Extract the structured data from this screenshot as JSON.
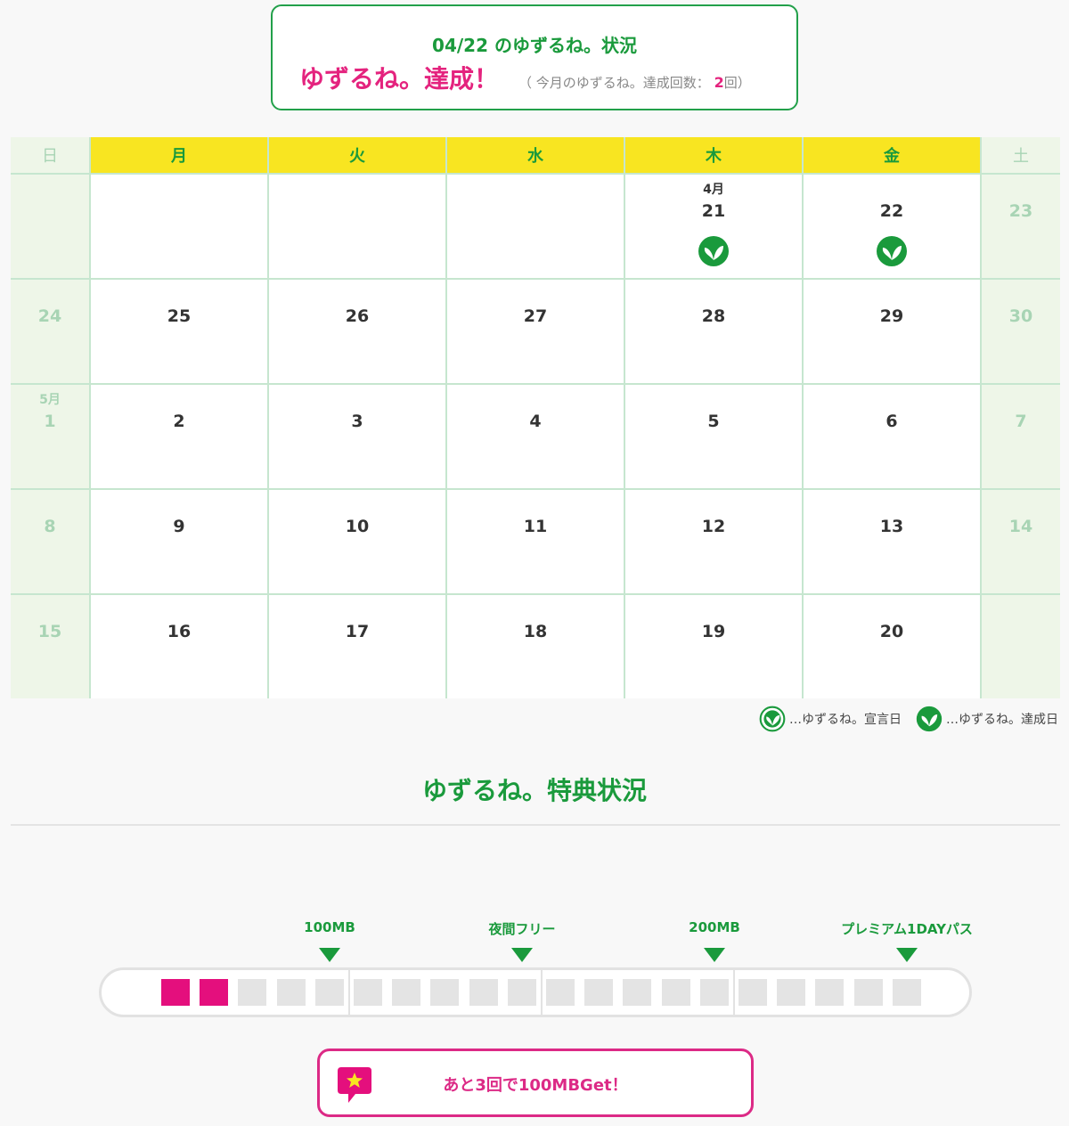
{
  "status": {
    "date_title": "04/22 のゆずるね。状況",
    "result": "ゆずるね。達成！",
    "count_prefix": "（ 今月のゆずるね。達成回数：",
    "count_value": "2",
    "count_suffix": "回）"
  },
  "calendar": {
    "headers": [
      "日",
      "月",
      "火",
      "水",
      "木",
      "金",
      "土"
    ],
    "weeks": [
      [
        {
          "day": ""
        },
        {
          "day": ""
        },
        {
          "day": ""
        },
        {
          "day": ""
        },
        {
          "month": "4月",
          "day": "21",
          "stamp": "achieved-icon"
        },
        {
          "day": "22",
          "stamp": "achieved-icon"
        },
        {
          "day": "23"
        }
      ],
      [
        {
          "day": "24"
        },
        {
          "day": "25"
        },
        {
          "day": "26"
        },
        {
          "day": "27"
        },
        {
          "day": "28"
        },
        {
          "day": "29"
        },
        {
          "day": "30"
        }
      ],
      [
        {
          "month": "5月",
          "day": "1"
        },
        {
          "day": "2"
        },
        {
          "day": "3"
        },
        {
          "day": "4"
        },
        {
          "day": "5"
        },
        {
          "day": "6"
        },
        {
          "day": "7"
        }
      ],
      [
        {
          "day": "8"
        },
        {
          "day": "9"
        },
        {
          "day": "10"
        },
        {
          "day": "11"
        },
        {
          "day": "12"
        },
        {
          "day": "13"
        },
        {
          "day": "14"
        }
      ],
      [
        {
          "day": "15"
        },
        {
          "day": "16"
        },
        {
          "day": "17"
        },
        {
          "day": "18"
        },
        {
          "day": "19"
        },
        {
          "day": "20"
        },
        {
          "day": ""
        }
      ]
    ]
  },
  "legend": {
    "declared": "…ゆずるね。宣言日",
    "achieved": "…ゆずるね。達成日"
  },
  "benefits": {
    "title": "ゆずるね。特典状況",
    "milestones": [
      "100MB",
      "夜間フリー",
      "200MB",
      "プレミアム1DAYパス"
    ],
    "progress": {
      "filled": 2,
      "total": 20
    },
    "hint": "あと3回で100MBGet！"
  },
  "colors": {
    "green": "#1a9a3c",
    "pink": "#e40f7d",
    "yellow": "#f8e521"
  }
}
